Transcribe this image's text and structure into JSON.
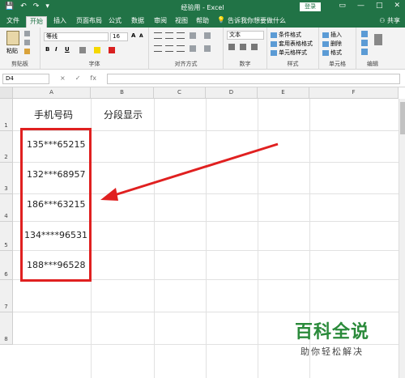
{
  "titlebar": {
    "title": "经验用 - Excel",
    "login_label": "登录",
    "quick_access": [
      "💾",
      "↶",
      "↷",
      "▾"
    ],
    "window_buttons": [
      "▭",
      "—",
      "□",
      "✕"
    ]
  },
  "menu": {
    "tabs": [
      "文件",
      "开始",
      "插入",
      "页面布局",
      "公式",
      "数据",
      "审阅",
      "视图",
      "帮助"
    ],
    "active_tab": "开始",
    "tell_me": "告诉我你想要做什么",
    "share": "共享"
  },
  "ribbon": {
    "clipboard": {
      "paste": "粘贴",
      "group": "剪贴板"
    },
    "font": {
      "name": "等线",
      "size": "16",
      "group": "字体",
      "bold": "B",
      "italic": "I",
      "underline": "U",
      "grow": "A",
      "shrink": "A"
    },
    "alignment": {
      "group": "对齐方式"
    },
    "number": {
      "format": "文本",
      "group": "数字"
    },
    "styles": {
      "cond_format": "条件格式",
      "table_format": "套用表格格式",
      "cell_styles": "单元格样式",
      "group": "样式"
    },
    "cells": {
      "insert": "插入",
      "delete": "删除",
      "format": "格式",
      "group": "单元格"
    },
    "editing": {
      "group": "编辑"
    }
  },
  "formula_bar": {
    "name_box": "D4",
    "cancel": "×",
    "enter": "✓",
    "fx": "fx",
    "value": ""
  },
  "sheet": {
    "columns": [
      "A",
      "B",
      "C",
      "D",
      "E",
      "F"
    ],
    "rows": [
      "1",
      "2",
      "3",
      "4",
      "5",
      "6",
      "7",
      "8"
    ],
    "header_a": "手机号码",
    "header_b": "分段显示",
    "phones": [
      "135***65215",
      "132***68957",
      "186***63215",
      "134****96531",
      "188***96528"
    ]
  },
  "annotation_color": "#e02020",
  "watermark": {
    "main": "百科全说",
    "sub": "助你轻松解决"
  }
}
